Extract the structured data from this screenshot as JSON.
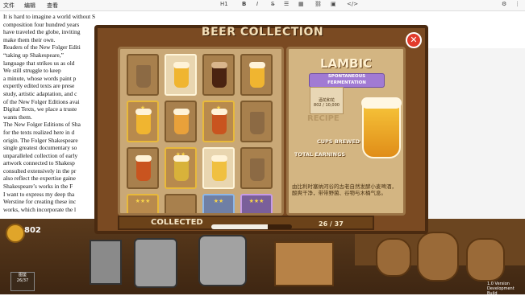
{
  "editor": {
    "menu": [
      "文件",
      "编辑",
      "查看"
    ],
    "heading_select": "H1"
  },
  "document": {
    "lines": [
      "It is hard to imagine a world without Shakespeare. Since their",
      "composition four hundred years",
      "have traveled the globe, inviting",
      "make them their own.",
      "Readers of the New Folger Editi",
      "“taking up Shakespeare,”",
      "language that strikes us as old",
      "We still struggle to keep",
      "a minute, whose words paint p",
      "expertly edited texts are prese",
      "study, artistic adaptation, and c",
      "of the New Folger Editions avai",
      "Digital Texts, we place a truste",
      "wants them.",
      "The New Folger Editions of Sha",
      "for the texts realized here in d",
      "origin. The Folger Shakespeare",
      "single greatest documentary so",
      "unparalleled collection of early",
      "artwork connected to Shakesp",
      "consulted extensively in the pr",
      "also reflect the expertise gaine",
      "Shakespeare’s works in the F",
      "I want to express my deep tha",
      "Werstine for creating these inc",
      "works, which incorporate the l"
    ]
  },
  "game": {
    "coins": "802",
    "tile_label_1": "图鉴",
    "tile_label_2": "26/37",
    "version_1": "1.0 Version",
    "version_2": "Development Build"
  },
  "modal": {
    "title": "BEER COLLECTION",
    "close_label": "✕",
    "detail": {
      "name": "LAMBIC",
      "ribbon_1": "SPONTANEOUS",
      "ribbon_2": "FERMENTATION",
      "recipe_title": "酒花和花",
      "recipe_count": "802 / 10,000",
      "recipe_label": "RECIPE",
      "cups_brewed": "CUPS BREWED",
      "total_earnings": "TOTAL EARNINGS",
      "description": "由比利时塞纳河谷的古老自然发酵小麦啤酒，酸爽干净，带带野菌、谷物与木桶气息。"
    },
    "collected_label": "COLLECTED",
    "collected_count": "26 / 37",
    "collected_fraction": 0.7027
  }
}
